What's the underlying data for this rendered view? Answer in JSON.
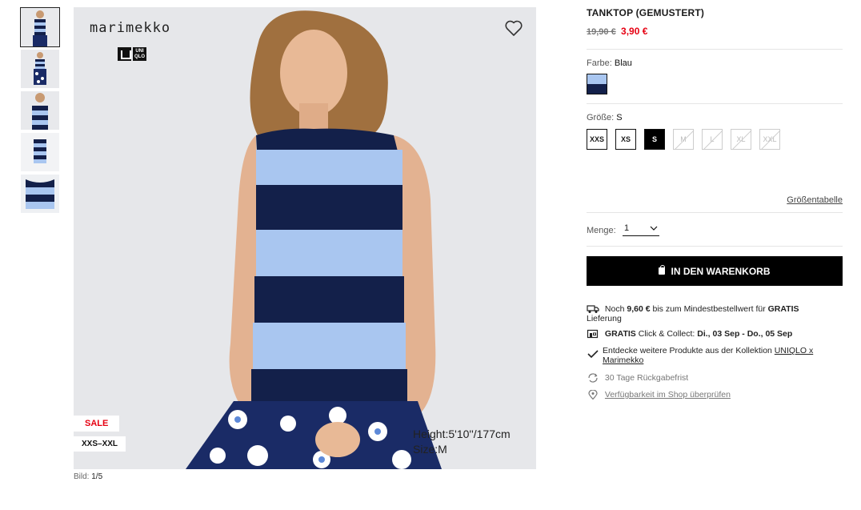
{
  "gallery": {
    "thumbnails": [
      "thumbnail-1",
      "thumbnail-2",
      "thumbnail-3",
      "thumbnail-4",
      "thumbnail-5"
    ],
    "counter_label": "Bild:",
    "counter_value": "1/5"
  },
  "hero": {
    "brand": "marimekko",
    "logo_text": "UNI QLO",
    "sale_badge": "SALE",
    "size_range_badge": "XXS–XXL",
    "model_height": "Height:5'10''/177cm",
    "model_size": "Size:M"
  },
  "product": {
    "title": "TANKTOP (GEMUSTERT)",
    "old_price": "19,90 €",
    "new_price": "3,90 €",
    "color_label": "Farbe:",
    "color_value": "Blau",
    "size_label": "Größe:",
    "size_value": "S",
    "sizes": [
      {
        "label": "XXS",
        "state": "available"
      },
      {
        "label": "XS",
        "state": "available"
      },
      {
        "label": "S",
        "state": "selected"
      },
      {
        "label": "M",
        "state": "unavailable"
      },
      {
        "label": "L",
        "state": "unavailable"
      },
      {
        "label": "XL",
        "state": "unavailable"
      },
      {
        "label": "XXL",
        "state": "unavailable"
      }
    ],
    "size_chart_link": "Größentabelle",
    "quantity_label": "Menge:",
    "quantity_value": "1",
    "add_to_cart": "IN DEN WARENKORB"
  },
  "info": {
    "shipping_pre": "Noch",
    "shipping_amount": "9,60 €",
    "shipping_mid": "bis zum Mindestbestellwert für",
    "shipping_bold": "GRATIS",
    "shipping_post": "Lieferung",
    "collect_bold": "GRATIS",
    "collect_text": "Click & Collect:",
    "collect_dates": "Di., 03 Sep - Do., 05 Sep",
    "collection_text": "Entdecke weitere Produkte aus der Kollektion",
    "collection_link": "UNIQLO x Marimekko",
    "returns_text": "30 Tage Rückgabefrist",
    "store_link": "Verfügbarkeit im Shop überprüfen"
  },
  "colors": {
    "sale_red": "#e60012",
    "stripe_navy": "#13204a",
    "stripe_light": "#a9c6f0"
  }
}
